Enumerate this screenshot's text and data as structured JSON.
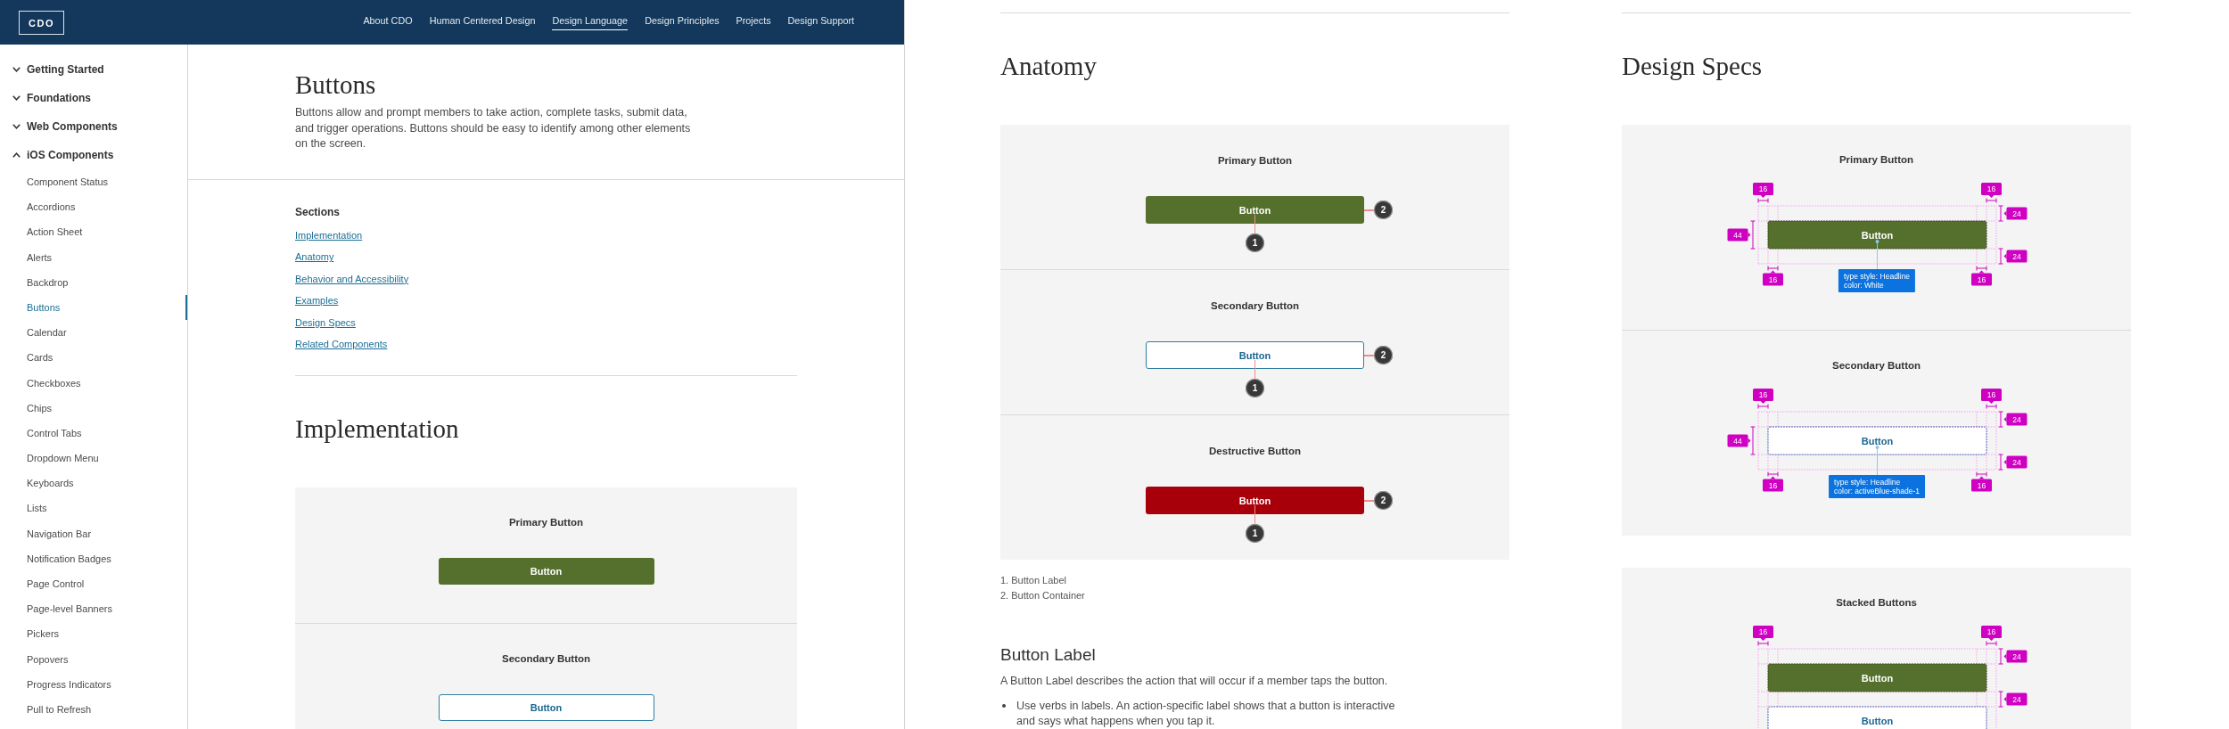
{
  "header": {
    "logo": "CDO",
    "nav": [
      {
        "label": "About CDO",
        "selected": false
      },
      {
        "label": "Human Centered Design",
        "selected": false
      },
      {
        "label": "Design Language",
        "selected": true
      },
      {
        "label": "Design Principles",
        "selected": false
      },
      {
        "label": "Projects",
        "selected": false
      },
      {
        "label": "Design Support",
        "selected": false
      }
    ]
  },
  "sidebar": {
    "groups": [
      {
        "label": "Getting Started",
        "expanded": false
      },
      {
        "label": "Foundations",
        "expanded": false
      },
      {
        "label": "Web Components",
        "expanded": false
      },
      {
        "label": "iOS Components",
        "expanded": true,
        "children": [
          {
            "label": "Component Status",
            "selected": false
          },
          {
            "label": "Accordions",
            "selected": false
          },
          {
            "label": "Action Sheet",
            "selected": false
          },
          {
            "label": "Alerts",
            "selected": false
          },
          {
            "label": "Backdrop",
            "selected": false
          },
          {
            "label": "Buttons",
            "selected": true
          },
          {
            "label": "Calendar",
            "selected": false
          },
          {
            "label": "Cards",
            "selected": false
          },
          {
            "label": "Checkboxes",
            "selected": false
          },
          {
            "label": "Chips",
            "selected": false
          },
          {
            "label": "Control Tabs",
            "selected": false
          },
          {
            "label": "Dropdown Menu",
            "selected": false
          },
          {
            "label": "Keyboards",
            "selected": false
          },
          {
            "label": "Lists",
            "selected": false
          },
          {
            "label": "Navigation Bar",
            "selected": false
          },
          {
            "label": "Notification Badges",
            "selected": false
          },
          {
            "label": "Page Control",
            "selected": false
          },
          {
            "label": "Page-level Banners",
            "selected": false
          },
          {
            "label": "Pickers",
            "selected": false
          },
          {
            "label": "Popovers",
            "selected": false
          },
          {
            "label": "Progress Indicators",
            "selected": false
          },
          {
            "label": "Pull to Refresh",
            "selected": false
          }
        ]
      }
    ]
  },
  "intro": {
    "title": "Buttons",
    "description": "Buttons allow and prompt members to take action, complete tasks, submit data, and trigger operations. Buttons should be easy to identify among other elements on the screen."
  },
  "sections": {
    "heading": "Sections",
    "links": [
      "Implementation",
      "Anatomy",
      "Behavior and Accessibility",
      "Examples",
      "Design Specs",
      "Related Components"
    ]
  },
  "implementation": {
    "heading": "Implementation",
    "examples": [
      {
        "title": "Primary Button",
        "kind": "primary",
        "button": "Button"
      },
      {
        "title": "Secondary Button",
        "kind": "secondary",
        "button": "Button"
      }
    ]
  },
  "anatomy": {
    "heading": "Anatomy",
    "examples": [
      {
        "title": "Primary Button",
        "kind": "primary",
        "button": "Button",
        "label_marker": "1",
        "container_marker": "2"
      },
      {
        "title": "Secondary Button",
        "kind": "secondary",
        "button": "Button",
        "label_marker": "1",
        "container_marker": "2"
      },
      {
        "title": "Destructive Button",
        "kind": "destructive",
        "button": "Button",
        "label_marker": "1",
        "container_marker": "2"
      }
    ],
    "legend": [
      "1. Button Label",
      "2. Button Container"
    ]
  },
  "button_label": {
    "heading": "Button Label",
    "description": "A Button Label describes the action that will occur if a member taps the button.",
    "bullets": [
      "Use verbs in labels. An action-specific label shows that a button is interactive and says what happens when you tap it."
    ]
  },
  "design_specs": {
    "heading": "Design Specs",
    "cards": [
      {
        "examples": [
          {
            "title": "Primary Button",
            "buttons": [
              {
                "kind": "primary",
                "label": "Button"
              }
            ],
            "tags": [
              {
                "kind": "margin_left",
                "value": "16"
              },
              {
                "kind": "margin_right",
                "value": "16"
              },
              {
                "kind": "margin_top",
                "value": "24"
              },
              {
                "kind": "height",
                "value": "44"
              },
              {
                "kind": "margin_bottom",
                "value": "24"
              },
              {
                "kind": "padding_left",
                "value": "16"
              },
              {
                "kind": "padding_right",
                "value": "16"
              }
            ],
            "note": [
              "type style: Headline",
              "color: White"
            ]
          },
          {
            "title": "Secondary Button",
            "buttons": [
              {
                "kind": "secondary",
                "label": "Button"
              }
            ],
            "tags": [
              {
                "kind": "margin_left",
                "value": "16"
              },
              {
                "kind": "margin_right",
                "value": "16"
              },
              {
                "kind": "margin_top",
                "value": "24"
              },
              {
                "kind": "height",
                "value": "44"
              },
              {
                "kind": "margin_bottom",
                "value": "24"
              },
              {
                "kind": "padding_left",
                "value": "16"
              },
              {
                "kind": "padding_right",
                "value": "16"
              }
            ],
            "note": [
              "type style: Headline",
              "color: activeBlue-shade-1"
            ]
          }
        ]
      },
      {
        "examples": [
          {
            "title": "Stacked Buttons",
            "buttons": [
              {
                "kind": "primary",
                "label": "Button"
              },
              {
                "kind": "secondary",
                "label": "Button"
              }
            ],
            "tags": [
              {
                "kind": "margin_left",
                "value": "16"
              },
              {
                "kind": "margin_right",
                "value": "16"
              },
              {
                "kind": "margin_top",
                "value": "24"
              },
              {
                "kind": "gap",
                "value": "24"
              }
            ]
          }
        ]
      }
    ]
  }
}
